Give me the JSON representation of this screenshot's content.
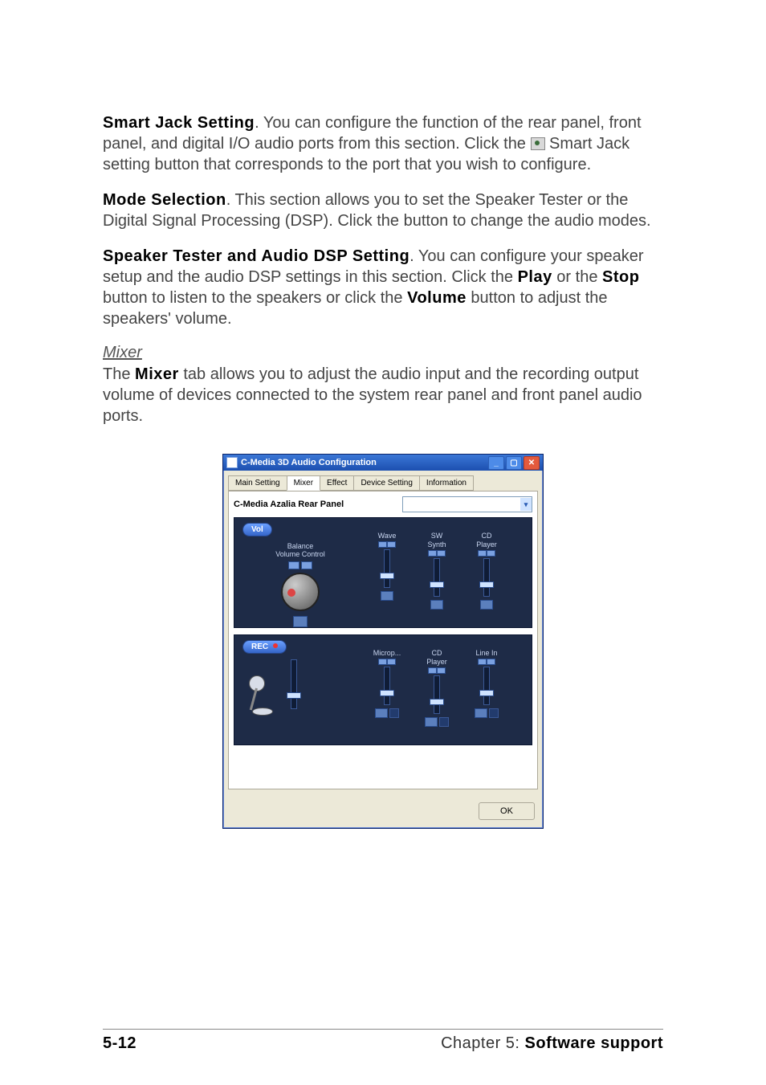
{
  "paragraphs": {
    "p1_hdr": "Smart Jack Setting",
    "p1_txt": ". You can configure the function of the rear panel, front panel, and digital I/O audio ports from this section. Click the ",
    "p1_txt2": " Smart Jack setting button that corresponds to the port that you wish to configure.",
    "p2_hdr": "Mode Selection",
    "p2_txt": ". This section allows you to set the Speaker Tester or the Digital Signal Processing (DSP). Click the button to change the audio modes.",
    "p3_hdr": "Speaker Tester and Audio DSP Setting",
    "p3_txt1": ". You can configure your speaker setup and the audio DSP settings in this section. Click the ",
    "p3_kw1": "Play",
    "p3_txt2": " or the ",
    "p3_kw2": "Stop",
    "p3_txt3": " button to listen to the speakers or click the ",
    "p3_kw3": "Volume",
    "p3_txt4": " button to adjust the speakers' volume.",
    "mixer_title": "Mixer",
    "p4_txt1": "The ",
    "p4_kw1": "Mixer",
    "p4_txt2": " tab allows you to adjust the audio input and the recording output volume of devices connected to the system rear panel and front panel audio ports."
  },
  "window": {
    "title": "C-Media 3D Audio Configuration",
    "tabs": [
      "Main Setting",
      "Mixer",
      "Effect",
      "Device Setting",
      "Information"
    ],
    "active_tab": "Mixer",
    "device_label": "C-Media Azalia Rear Panel",
    "vol_panel_title": "Vol",
    "balance_label": "Balance",
    "volume_control_label": "Volume Control",
    "playback_channels": [
      {
        "l1": "Wave",
        "l2": ""
      },
      {
        "l1": "SW",
        "l2": "Synth"
      },
      {
        "l1": "CD",
        "l2": "Player"
      }
    ],
    "rec_panel_title": "REC",
    "record_channels": [
      {
        "l1": "Microp...",
        "l2": ""
      },
      {
        "l1": "CD",
        "l2": "Player"
      },
      {
        "l1": "Line In",
        "l2": ""
      }
    ],
    "ok_button": "OK"
  },
  "footer": {
    "page": "5-12",
    "chapter_pre": "Chapter 5: ",
    "chapter_bold": "Software support"
  }
}
